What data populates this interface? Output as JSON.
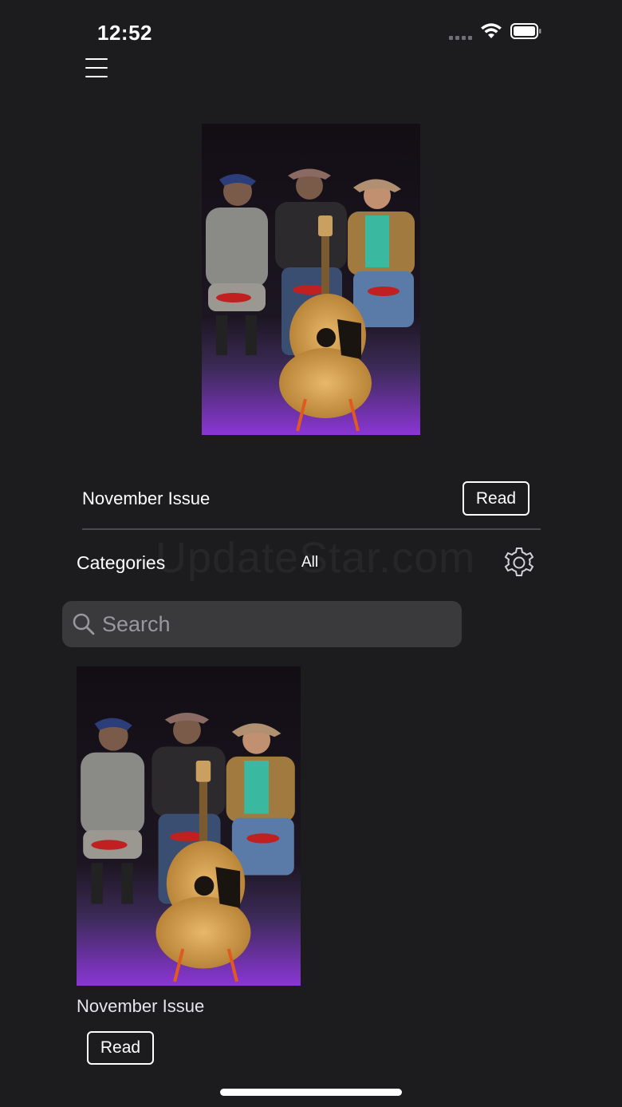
{
  "status_bar": {
    "time": "12:52",
    "signal_icon": "cellular-signal-dots",
    "wifi_icon": "wifi-icon",
    "battery_icon": "battery-full-icon"
  },
  "nav": {
    "menu_icon": "hamburger-menu-icon"
  },
  "featured": {
    "title": "November Issue",
    "read_label": "Read",
    "cover_description_icon": "magazine-cover-image"
  },
  "categories": {
    "label": "Categories",
    "selected": "All",
    "settings_icon": "gear-icon",
    "watermark": "UpdateStar.com"
  },
  "search": {
    "placeholder": "Search",
    "value": ""
  },
  "issues": [
    {
      "title": "November Issue",
      "read_label": "Read"
    }
  ],
  "colors": {
    "background": "#1c1c1e",
    "search_field": "#3a3a3c",
    "divider": "#4a4a4e",
    "text": "#ffffff"
  }
}
